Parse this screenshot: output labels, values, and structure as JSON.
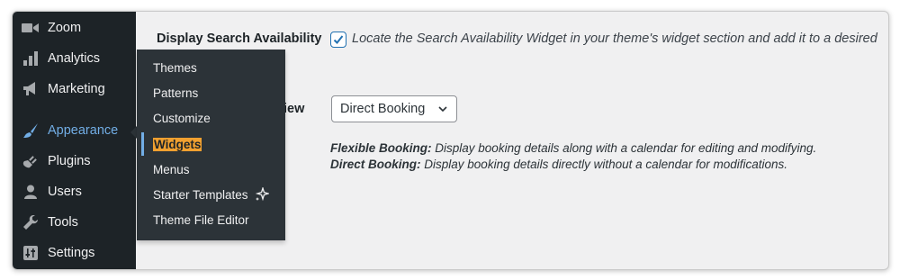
{
  "sidebar": {
    "items": [
      {
        "label": "Zoom",
        "icon": "video-camera-icon"
      },
      {
        "label": "Analytics",
        "icon": "bar-chart-icon"
      },
      {
        "label": "Marketing",
        "icon": "megaphone-icon"
      },
      {
        "label": "Appearance",
        "icon": "paintbrush-icon",
        "active": true
      },
      {
        "label": "Plugins",
        "icon": "plug-icon"
      },
      {
        "label": "Users",
        "icon": "user-icon"
      },
      {
        "label": "Tools",
        "icon": "wrench-icon"
      },
      {
        "label": "Settings",
        "icon": "sliders-icon"
      }
    ],
    "active_color": "#72aee6"
  },
  "submenu": {
    "items": [
      {
        "label": "Themes"
      },
      {
        "label": "Patterns"
      },
      {
        "label": "Customize"
      },
      {
        "label": "Widgets",
        "current": true
      },
      {
        "label": "Menus"
      },
      {
        "label": "Starter Templates",
        "icon": "sparkle-icon"
      },
      {
        "label": "Theme File Editor"
      }
    ],
    "highlight_color": "#f0a030"
  },
  "settings": {
    "search_availability": {
      "label": "Display Search Availability",
      "checked": true,
      "description": "Locate the Search Availability Widget in your theme's widget section and add it to a desired"
    },
    "view": {
      "label_visible": "iew",
      "selected": "Direct Booking"
    },
    "help": {
      "flexible_title": "Flexible Booking:",
      "flexible_text": "Display booking details along with a calendar for editing and modifying.",
      "direct_title": "Direct Booking:",
      "direct_text": "Display booking details directly without a calendar for modifications."
    }
  }
}
